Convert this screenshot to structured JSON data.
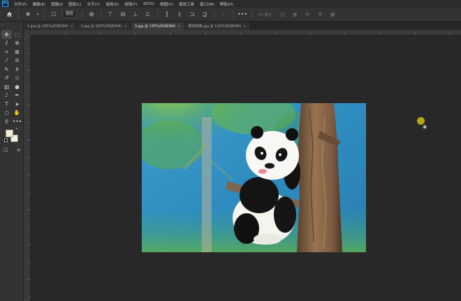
{
  "app": {
    "logo": "Ps"
  },
  "menu": [
    "文件(F)",
    "编辑(E)",
    "图像(I)",
    "图层(L)",
    "文字(Y)",
    "选择(S)",
    "滤镜(T)",
    "3D(D)",
    "视图(V)",
    "增效工具",
    "窗口(W)",
    "帮助(H)"
  ],
  "options": {
    "auto_select_value": "图层",
    "mode_3d_label": "3D 模式:"
  },
  "tabs": [
    {
      "label": "1.jpg @ 100%(RGB/8#)",
      "active": false
    },
    {
      "label": "2.jpg @ 100%(RGB/8#)",
      "active": false
    },
    {
      "label": "3.jpg @ 135%(RGB/8#)",
      "active": true
    },
    {
      "label": "酷狗搜索.jpg @ 110%(RGB/8#)",
      "active": false
    }
  ],
  "tab_close": "×",
  "colors": {
    "foreground": "#f2ecd7",
    "background": "#f5efdc",
    "cursor": "#c6b21a"
  },
  "icons": {
    "home": "home-icon",
    "move": "move-icon",
    "panda_photo": "panda-in-tree-photo"
  }
}
